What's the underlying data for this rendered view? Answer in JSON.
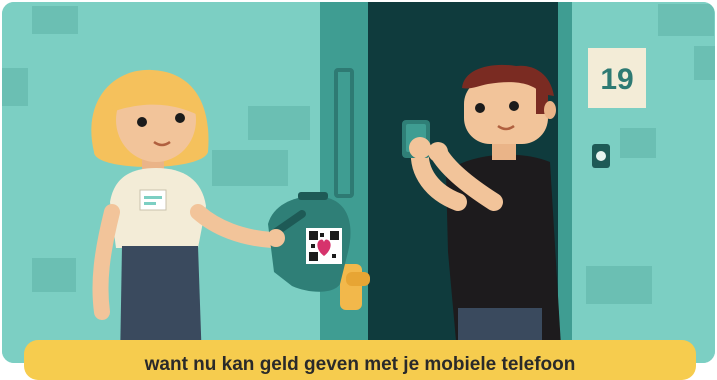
{
  "scene": {
    "door_number": "19",
    "caption": "want nu kan geld geven met je mobiele telefoon"
  },
  "colors": {
    "wall": "#7ccfc3",
    "wall_block": "#6bbfb3",
    "door_frame": "#2e7a73",
    "door_inside": "#0f3b3d",
    "caption_bar": "#f6cc4e",
    "collection_box": "#2f7f77",
    "handle": "#f2b84b"
  },
  "icons": [
    "qr-code-icon",
    "heart-icon",
    "doorbell-icon",
    "phone-icon"
  ]
}
